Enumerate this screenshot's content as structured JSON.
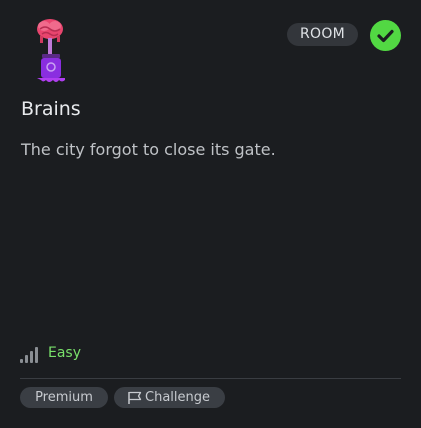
{
  "card": {
    "type_badge": "ROOM",
    "title": "Brains",
    "description": "The city forgot to close its gate.",
    "difficulty": "Easy",
    "tags": [
      "Premium",
      "Challenge"
    ],
    "icons": {
      "room": "brain-in-jar-icon",
      "completed": "check-circle-icon",
      "difficulty": "signal-bars-icon",
      "challenge": "flag-icon"
    },
    "colors": {
      "completed": "#52d843",
      "difficulty_easy": "#78e06a"
    }
  }
}
